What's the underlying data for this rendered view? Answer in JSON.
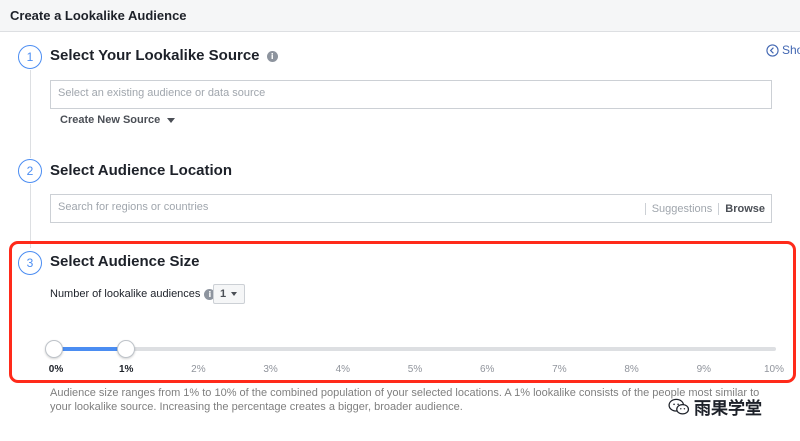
{
  "window": {
    "title": "Create a Lookalike Audience"
  },
  "show_link": {
    "label": "Sho"
  },
  "steps": [
    {
      "number": "1",
      "title": "Select Your Lookalike Source"
    },
    {
      "number": "2",
      "title": "Select Audience Location"
    },
    {
      "number": "3",
      "title": "Select Audience Size"
    }
  ],
  "source": {
    "placeholder": "Select an existing audience or data source",
    "create_new_label": "Create New Source"
  },
  "location": {
    "placeholder": "Search for regions or countries",
    "suggestions_label": "Suggestions",
    "browse_label": "Browse"
  },
  "size": {
    "num_label": "Number of lookalike audiences",
    "num_value": "1",
    "slider": {
      "range_start_percent": 0,
      "range_end_percent": 1,
      "ticks": [
        "0%",
        "1%",
        "2%",
        "3%",
        "4%",
        "5%",
        "6%",
        "7%",
        "8%",
        "9%",
        "10%"
      ]
    },
    "description": "Audience size ranges from 1% to 10% of the combined population of your selected locations. A 1% lookalike consists of the people most similar to your lookalike source. Increasing the percentage creates a bigger, broader audience."
  },
  "watermark": {
    "text": "雨果学堂",
    "icon": "wechat-icon"
  },
  "colors": {
    "accent": "#4b8df2",
    "highlight": "#ff2a1a",
    "link": "#4267b2"
  }
}
